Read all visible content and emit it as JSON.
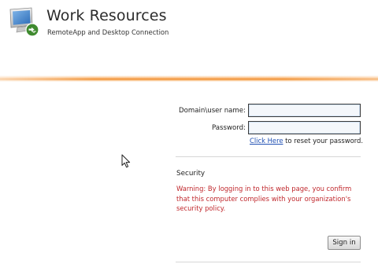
{
  "header": {
    "title": "Work Resources",
    "subtitle": "RemoteApp and Desktop Connection",
    "logo_icon": "remote-desktop-computer-icon",
    "accent_color": "#f08f2f"
  },
  "form": {
    "username_label": "Domain\\user name:",
    "username_value": "",
    "password_label": "Password:",
    "password_value": "",
    "reset_link": "Click Here",
    "reset_text": " to reset your password."
  },
  "security": {
    "title": "Security",
    "warning": "Warning: By logging in to this web page, you confirm that this computer complies with your organization's security policy.",
    "warning_color": "#c0282d"
  },
  "actions": {
    "signin_label": "Sign in"
  }
}
